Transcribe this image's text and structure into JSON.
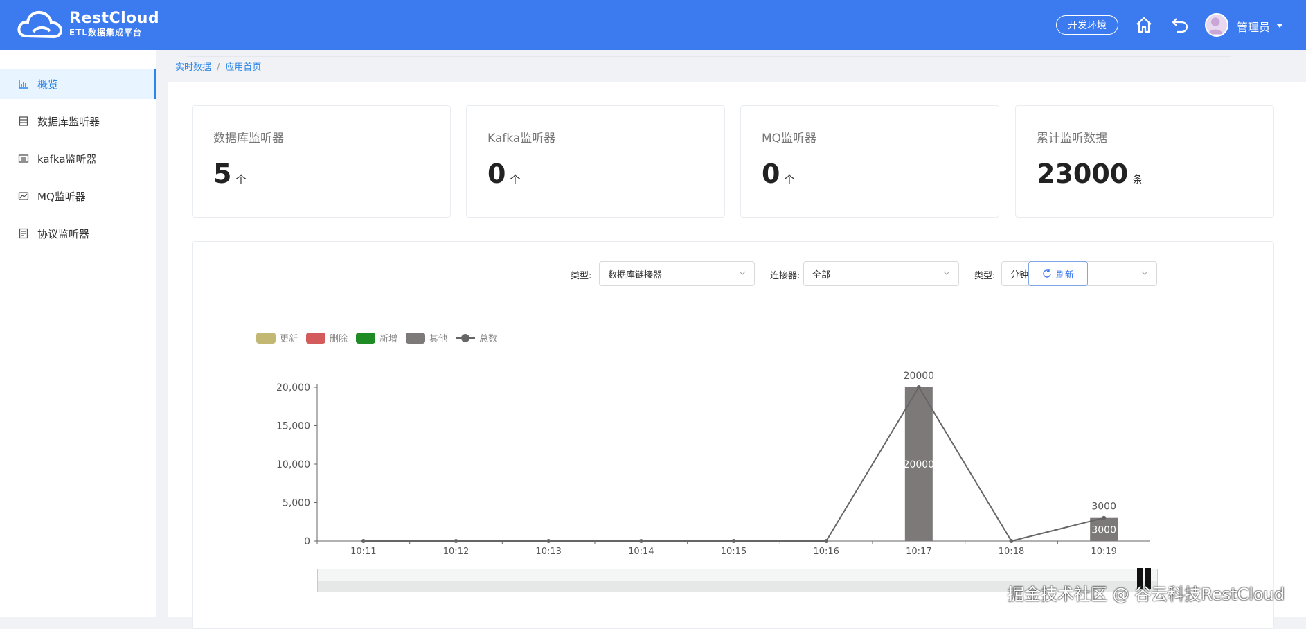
{
  "header": {
    "logo_title": "RestCloud",
    "logo_subtitle": "ETL数据集成平台",
    "env_label": "开发环境",
    "user_name": "管理员",
    "bg_color": "#3c7af0"
  },
  "sidebar": {
    "items": [
      {
        "label": "概览",
        "icon": "bar-chart-icon",
        "active": true
      },
      {
        "label": "数据库监听器",
        "icon": "database-icon"
      },
      {
        "label": "kafka监听器",
        "icon": "list-icon"
      },
      {
        "label": "MQ监听器",
        "icon": "message-icon"
      },
      {
        "label": "协议监听器",
        "icon": "document-icon"
      }
    ]
  },
  "breadcrumb": {
    "items": [
      "实时数据",
      "应用首页"
    ]
  },
  "cards": [
    {
      "title": "数据库监听器",
      "value": "5",
      "unit": "个"
    },
    {
      "title": "Kafka监听器",
      "value": "0",
      "unit": "个"
    },
    {
      "title": "MQ监听器",
      "value": "0",
      "unit": "个"
    },
    {
      "title": "累计监听数据",
      "value": "23000",
      "unit": "条"
    }
  ],
  "filters": {
    "type_label": "类型:",
    "type_value": "数据库链接器",
    "connector_label": "连接器:",
    "connector_value": "全部",
    "granularity_label": "类型:",
    "granularity_value": "分钟",
    "refresh_label": "刷新"
  },
  "chart_data": {
    "type": "bar",
    "categories": [
      "10:11",
      "10:12",
      "10:13",
      "10:14",
      "10:15",
      "10:16",
      "10:17",
      "10:18",
      "10:19"
    ],
    "series": [
      {
        "name": "更新",
        "type": "bar",
        "color": "#c2b873",
        "values": [
          0,
          0,
          0,
          0,
          0,
          0,
          0,
          0,
          0
        ]
      },
      {
        "name": "删除",
        "type": "bar",
        "color": "#d35b5b",
        "values": [
          0,
          0,
          0,
          0,
          0,
          0,
          0,
          0,
          0
        ]
      },
      {
        "name": "新增",
        "type": "bar",
        "color": "#1f8b24",
        "values": [
          0,
          0,
          0,
          0,
          0,
          0,
          0,
          0,
          0
        ]
      },
      {
        "name": "其他",
        "type": "bar",
        "color": "#7d7979",
        "values": [
          0,
          0,
          0,
          0,
          0,
          0,
          20000,
          0,
          3000
        ]
      },
      {
        "name": "总数",
        "type": "line",
        "color": "#666666",
        "values": [
          0,
          0,
          0,
          0,
          0,
          0,
          20000,
          0,
          3000
        ]
      }
    ],
    "y_ticks": [
      "0",
      "5,000",
      "10,000",
      "15,000",
      "20,000"
    ],
    "ylim": [
      0,
      20000
    ],
    "grid": false,
    "legend_position": "top-left",
    "bar_labels": [
      "20000",
      "3000"
    ],
    "line_labels": [
      "20000",
      "3000"
    ]
  },
  "watermark": "掘金技术社区 @ 谷云科技RestCloud"
}
